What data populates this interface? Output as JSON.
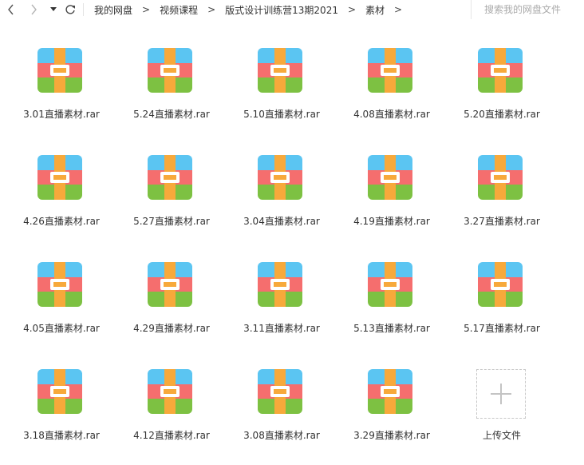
{
  "toolbar": {
    "back_icon": "chevron-left-icon",
    "forward_icon": "chevron-right-icon",
    "dropdown_icon": "caret-down-icon",
    "refresh_icon": "refresh-icon"
  },
  "breadcrumb": [
    "我的网盘",
    "视频课程",
    "版式设计训练营13期2021",
    "素材"
  ],
  "breadcrumb_separator": ">",
  "search": {
    "placeholder": "搜索我的网盘文件"
  },
  "files": [
    "3.01直播素材.rar",
    "5.24直播素材.rar",
    "5.10直播素材.rar",
    "4.08直播素材.rar",
    "5.20直播素材.rar",
    "4.26直播素材.rar",
    "5.27直播素材.rar",
    "3.04直播素材.rar",
    "4.19直播素材.rar",
    "3.27直播素材.rar",
    "4.05直播素材.rar",
    "4.29直播素材.rar",
    "3.11直播素材.rar",
    "5.13直播素材.rar",
    "5.17直播素材.rar",
    "3.18直播素材.rar",
    "4.12直播素材.rar",
    "3.08直播素材.rar",
    "3.29直播素材.rar"
  ],
  "upload": {
    "label": "上传文件",
    "icon": "plus-icon"
  },
  "colors": {
    "archive_top": "#5bc5f2",
    "archive_mid": "#f56e6e",
    "archive_bottom": "#7dc142",
    "archive_strap": "#f7a93b"
  }
}
